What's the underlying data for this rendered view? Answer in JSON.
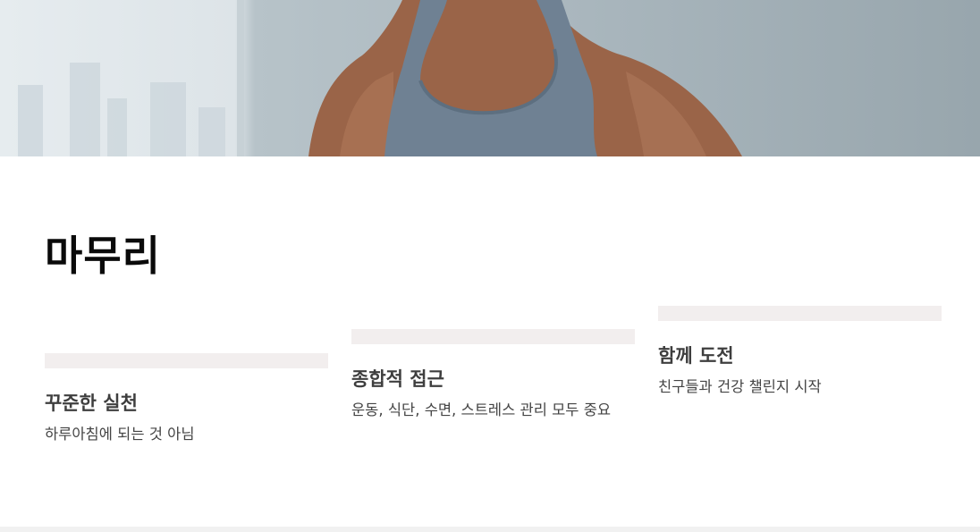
{
  "hero": {
    "image": "fitness-athlete-photo"
  },
  "section": {
    "title": "마무리"
  },
  "cards": [
    {
      "heading": "꾸준한 실천",
      "description": "하루아침에 되는 것 아님"
    },
    {
      "heading": "종합적 접근",
      "description": "운동, 식단, 수면, 스트레스 관리 모두 중요"
    },
    {
      "heading": "함께 도전",
      "description": "친구들과 건강 챌린지 시작"
    }
  ],
  "colors": {
    "title": "#0a0a0a",
    "heading": "#3e3e3e",
    "description": "#444444",
    "accent_bar": "#f2eeee",
    "background": "#ffffff"
  }
}
